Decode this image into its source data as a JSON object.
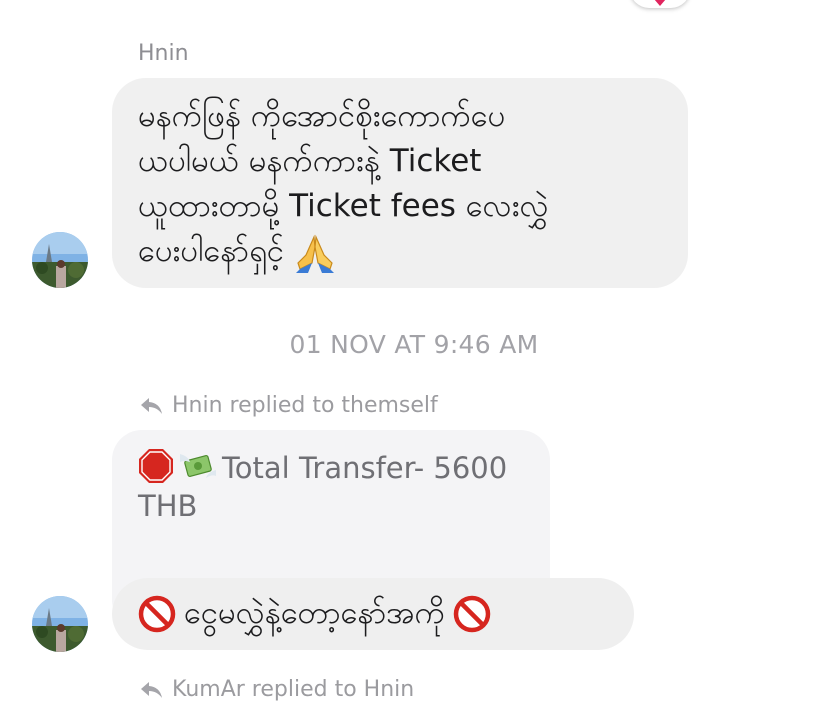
{
  "message_1": {
    "sender": "Hnin",
    "text": "မနက်ဖြန် ကိုအောင်စိုးကောက်ပေ\nယပါမယ် မနက်ကားနဲ့ Ticket\nယူထားတာမို့ Ticket fees လေးလွှဲ\nပေးပါနော်ရှင့်",
    "emoji": "folded-hands"
  },
  "timestamp": "01 NOV AT 9:46 AM",
  "reply_1": {
    "label": "Hnin replied to themself",
    "quoted_text": "Total Transfer- 5600 THB",
    "quoted_emojis": [
      "stop-sign",
      "money-with-wings"
    ],
    "text": "ငွေမလွှဲနဲ့တော့နော်အကို",
    "emojis": [
      "prohibited",
      "prohibited"
    ]
  },
  "reply_2": {
    "label": "KumAr replied to Hnin"
  },
  "colors": {
    "bubble": "#f0f0f0",
    "meta_text": "#8e8e93",
    "reaction_heart": "#e0245e"
  }
}
